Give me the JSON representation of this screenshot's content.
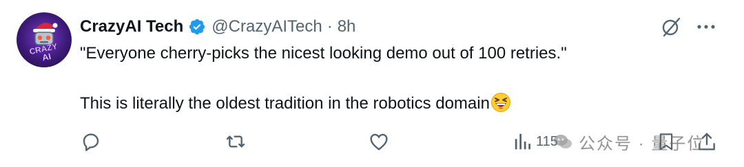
{
  "author": {
    "name": "CrazyAI Tech",
    "handle": "@CrazyAITech",
    "separator": "·",
    "time": "8h",
    "avatar_text": "CRAZY AI"
  },
  "tweet": {
    "line1": "\"Everyone cherry-picks the nicest looking demo out of 100 retries.\"",
    "line2": "This is literally the oldest tradition in the robotics domain",
    "emoji": "grinning-squinting-face"
  },
  "actions": {
    "views_count": "115"
  },
  "watermark": {
    "text": "公众号 · 量子位"
  },
  "colors": {
    "text": "#0f1419",
    "secondary": "#536471",
    "verified_blue": "#1d9bf0"
  },
  "icons": [
    "verified-badge-icon",
    "grok-icon",
    "more-icon",
    "reply-icon",
    "repost-icon",
    "like-icon",
    "views-icon",
    "bookmark-icon",
    "share-icon"
  ]
}
